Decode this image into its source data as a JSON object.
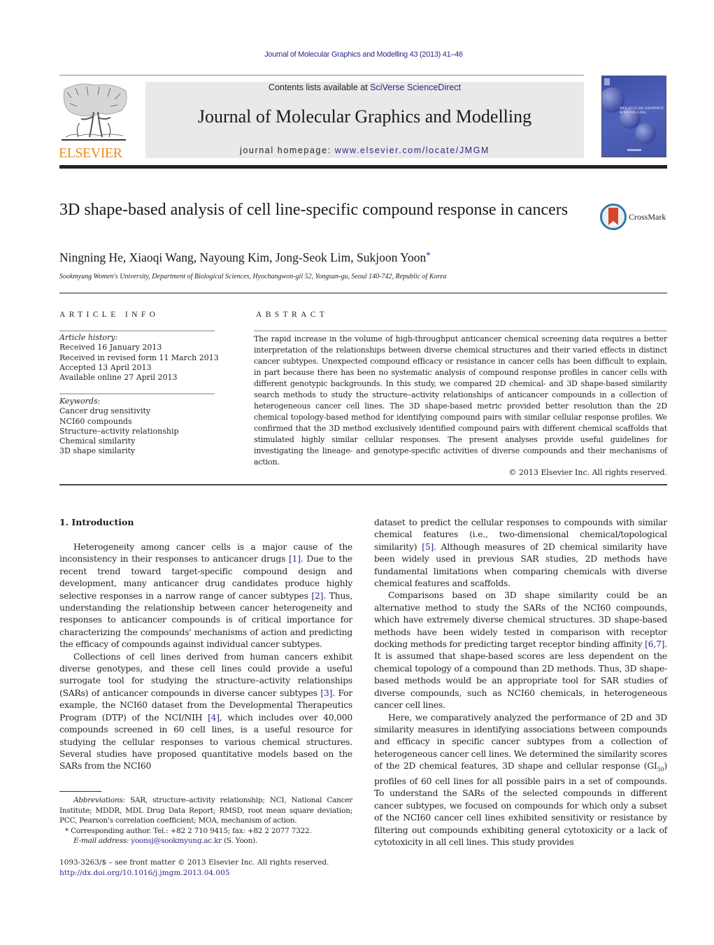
{
  "header": {
    "journal_ref": "Journal of Molecular Graphics and Modelling 43 (2013) 41–46",
    "contents_prefix": "Contents lists available at ",
    "contents_link": "SciVerse ScienceDirect",
    "journal_title": "Journal of Molecular Graphics and Modelling",
    "homepage_prefix": "journal homepage: ",
    "homepage_link": "www.elsevier.com/locate/JMGM",
    "publisher_logo_text": "ELSEVIER",
    "cover_title_line1": "MOLECULAR GRAPHICS",
    "cover_title_line2": "& MODELLING"
  },
  "article": {
    "title": "3D shape-based analysis of cell line-specific compound response in cancers",
    "crossmark_label": "CrossMark",
    "authors": "Ningning He, Xiaoqi Wang, Nayoung Kim, Jong-Seok Lim, Sukjoon Yoon",
    "author_mark": "*",
    "affiliation": "Sookmyung Women's University, Department of Biological Sciences, Hyochangwon-gil 52, Yongsan-gu, Seoul 140-742, Republic of Korea"
  },
  "article_info": {
    "heading": "ARTICLE INFO",
    "history_label": "Article history:",
    "history": [
      "Received 16 January 2013",
      "Received in revised form 11 March 2013",
      "Accepted 13 April 2013",
      "Available online 27 April 2013"
    ],
    "keywords_label": "Keywords:",
    "keywords": [
      "Cancer drug sensitivity",
      "NCI60 compounds",
      "Structure–activity relationship",
      "Chemical similarity",
      "3D shape similarity"
    ]
  },
  "abstract": {
    "heading": "ABSTRACT",
    "text": "The rapid increase in the volume of high-throughput anticancer chemical screening data requires a better interpretation of the relationships between diverse chemical structures and their varied effects in distinct cancer subtypes. Unexpected compound efficacy or resistance in cancer cells has been difficult to explain, in part because there has been no systematic analysis of compound response profiles in cancer cells with different genotypic backgrounds. In this study, we compared 2D chemical- and 3D shape-based similarity search methods to study the structure–activity relationships of anticancer compounds in a collection of heterogeneous cancer cell lines. The 3D shape-based metric provided better resolution than the 2D chemical topology-based method for identifying compound pairs with similar cellular response profiles. We confirmed that the 3D method exclusively identified compound pairs with different chemical scaffolds that stimulated highly similar cellular responses. The present analyses provide useful guidelines for investigating the lineage- and genotype-specific activities of diverse compounds and their mechanisms of action.",
    "copyright": "© 2013 Elsevier Inc. All rights reserved."
  },
  "body": {
    "section_title": "1.  Introduction",
    "p1": [
      "Heterogeneity among cancer cells is a major cause of the inconsistency in their responses to anticancer drugs ",
      "[1]",
      ". Due to the recent trend toward target-specific compound design and development, many anticancer drug candidates produce highly selective responses in a narrow range of cancer subtypes ",
      "[2]",
      ". Thus, understanding the relationship between cancer heterogeneity and responses to anticancer compounds is of critical importance for characterizing the compounds' mechanisms of action and predicting the efficacy of compounds against individual cancer subtypes."
    ],
    "p2": [
      "Collections of cell lines derived from human cancers exhibit diverse genotypes, and these cell lines could provide a useful surrogate tool for studying the structure–activity relationships (SARs) of anticancer compounds in diverse cancer subtypes ",
      "[3]",
      ". For example, the NCI60 dataset from the Developmental Therapeutics Program (DTP) of the NCI/NIH ",
      "[4]",
      ", which includes over 40,000 compounds screened in 60 cell lines, is a useful resource for studying the cellular responses to various chemical structures. Several studies have proposed quantitative models based on the SARs from the NCI60"
    ],
    "p2_cont": [
      "dataset to predict the cellular responses to compounds with similar chemical features (i.e., two-dimensional chemical/topological similarity) ",
      "[5]",
      ". Although measures of 2D chemical similarity have been widely used in previous SAR studies, 2D methods have fundamental limitations when comparing chemicals with diverse chemical features and scaffolds."
    ],
    "p3": [
      "Comparisons based on 3D shape similarity could be an alternative method to study the SARs of the NCI60 compounds, which have extremely diverse chemical structures. 3D shape-based methods have been widely tested in comparison with receptor docking methods for predicting target receptor binding affinity ",
      "[6,7]",
      ". It is assumed that shape-based scores are less dependent on the chemical topology of a compound than 2D methods. Thus, 3D shape-based methods would be an appropriate tool for SAR studies of diverse compounds, such as NCI60 chemicals, in heterogeneous cancer cell lines."
    ],
    "p4_a": "Here, we comparatively analyzed the performance of 2D and 3D similarity measures in identifying associations between compounds and efficacy in specific cancer subtypes from a collection of heterogeneous cancer cell lines. We determined the similarity scores of the 2D chemical features, 3D shape and cellular response (GI",
    "p4_sub": "50",
    "p4_b": ") profiles of 60 cell lines for all possible pairs in a set of compounds. To understand the SARs of the selected compounds in different cancer subtypes, we focused on compounds for which only a subset of the NCI60 cancer cell lines exhibited sensitivity or resistance by filtering out compounds exhibiting general cytotoxicity or a lack of cytotoxicity in all cell lines. This study provides"
  },
  "footnotes": {
    "abbrev_label": "Abbreviations:",
    "abbrev_text": "  SAR, structure–activity relationship; NCI, National Cancer Institute; MDDR, MDL Drug Data Report; RMSD, root mean square deviation; PCC, Pearson's correlation coefficient; MOA, mechanism of action.",
    "corr_mark": "*",
    "corr_text": " Corresponding author. Tel.: +82 2 710 9415; fax: +82 2 2077 7322.",
    "email_label": "E-mail address:",
    "email": "yoonsj@sookmyung.ac.kr",
    "email_suffix": " (S. Yoon).",
    "issn": "1093-3263/$ – see front matter © 2013 Elsevier Inc. All rights reserved.",
    "doi": "http://dx.doi.org/10.1016/j.jmgm.2013.04.005"
  },
  "colors": {
    "link": "#2a2a8c",
    "elsevier_orange": "#f08a1c",
    "masthead_bg": "#e9e9e9",
    "cover_blue": "#4454aa"
  }
}
